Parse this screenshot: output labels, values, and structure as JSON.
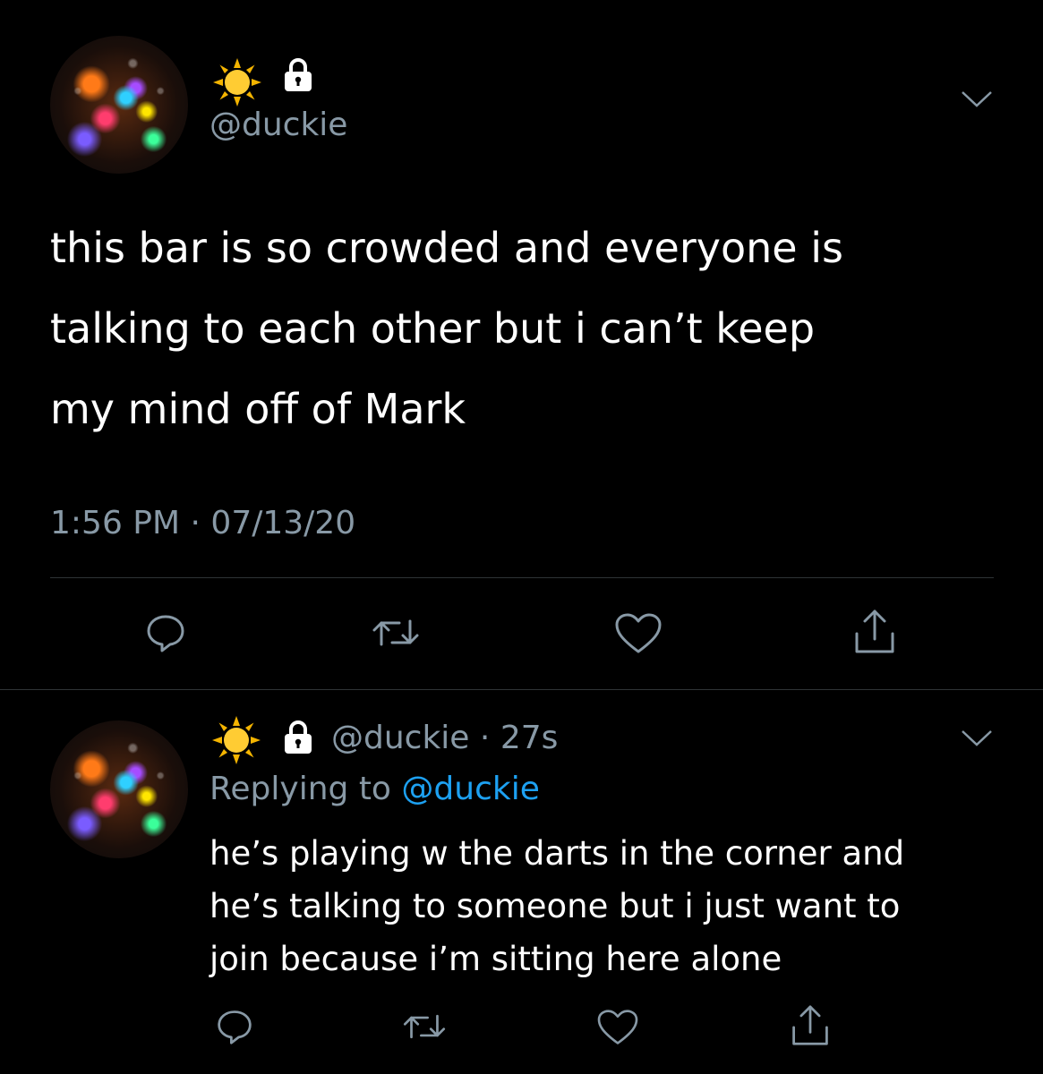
{
  "tweet": {
    "username": "@duckie",
    "text_lines": [
      "this bar is so crowded and everyone is",
      "talking to each other but i can’t keep",
      "my mind off of Mark"
    ],
    "time": "1:56 PM",
    "separator": "·",
    "date": "07/13/20",
    "icons": [
      "sun-emoji",
      "lock-icon",
      "chevron-down-icon",
      "reply-icon",
      "retweet-icon",
      "like-icon",
      "share-icon"
    ]
  },
  "reply": {
    "username": "@duckie",
    "separator": "·",
    "age": "27s",
    "replying_prefix": "Replying to",
    "replying_to": "@duckie",
    "text_lines": [
      "he’s playing w the darts in the corner and",
      "he’s talking to someone but i just want to",
      "join because i’m sitting here alone"
    ],
    "icons": [
      "sun-emoji",
      "lock-icon",
      "chevron-down-icon",
      "reply-icon",
      "retweet-icon",
      "like-icon",
      "share-icon"
    ]
  },
  "colors": {
    "background": "#000000",
    "text": "#ffffff",
    "muted": "#8899a6",
    "mention": "#1da1f2",
    "divider": "#2f3336"
  }
}
